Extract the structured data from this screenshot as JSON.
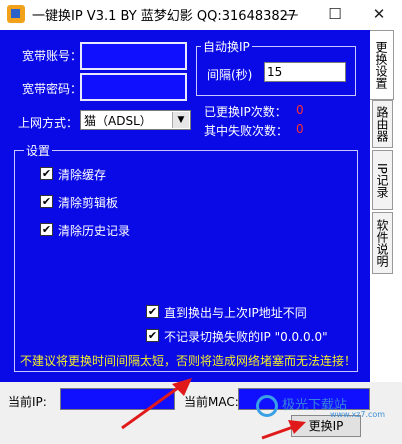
{
  "window": {
    "title": "一键换IP V3.1 BY 蓝梦幻影 QQ:316483827",
    "minimize": "—",
    "maximize": "☐",
    "close": "✕"
  },
  "account": {
    "username_label": "宽带账号：",
    "password_label": "宽带密码：",
    "net_label": "上网方式：",
    "net_value": "猫（ADSL）"
  },
  "auto": {
    "group_title": "自动换IP",
    "interval_label": "间隔(秒)",
    "interval_value": "15"
  },
  "stats": {
    "changed_label": "已更换IP次数：",
    "changed_value": "0",
    "failed_label": "其中失败次数：",
    "failed_value": "0"
  },
  "settings": {
    "group_title": "设置",
    "options": [
      {
        "label": "清除缓存",
        "checked": true
      },
      {
        "label": "清除剪辑板",
        "checked": true
      },
      {
        "label": "清除历史记录",
        "checked": true
      },
      {
        "label": "直到换出与上次IP地址不同",
        "checked": true
      },
      {
        "label": "不记录切换失败的IP \"0.0.0.0\"",
        "checked": true
      }
    ],
    "warning": "不建议将更换时间间隔太短，否则将造成网络堵塞而无法连接！"
  },
  "tabs": [
    "更换设置",
    "路由器",
    "IP记录",
    "软件说明"
  ],
  "bottom": {
    "current_ip_label": "当前IP:",
    "current_mac_label": "当前MAC:",
    "change_button": "更换IP",
    "watermark": "极光下载站",
    "watermark_sub": "www.xz7.com"
  },
  "colors": {
    "panel": "#0a0ae6",
    "field": "#1010ff",
    "warning": "#f2ee2a",
    "accent_red": "#ff3030"
  }
}
